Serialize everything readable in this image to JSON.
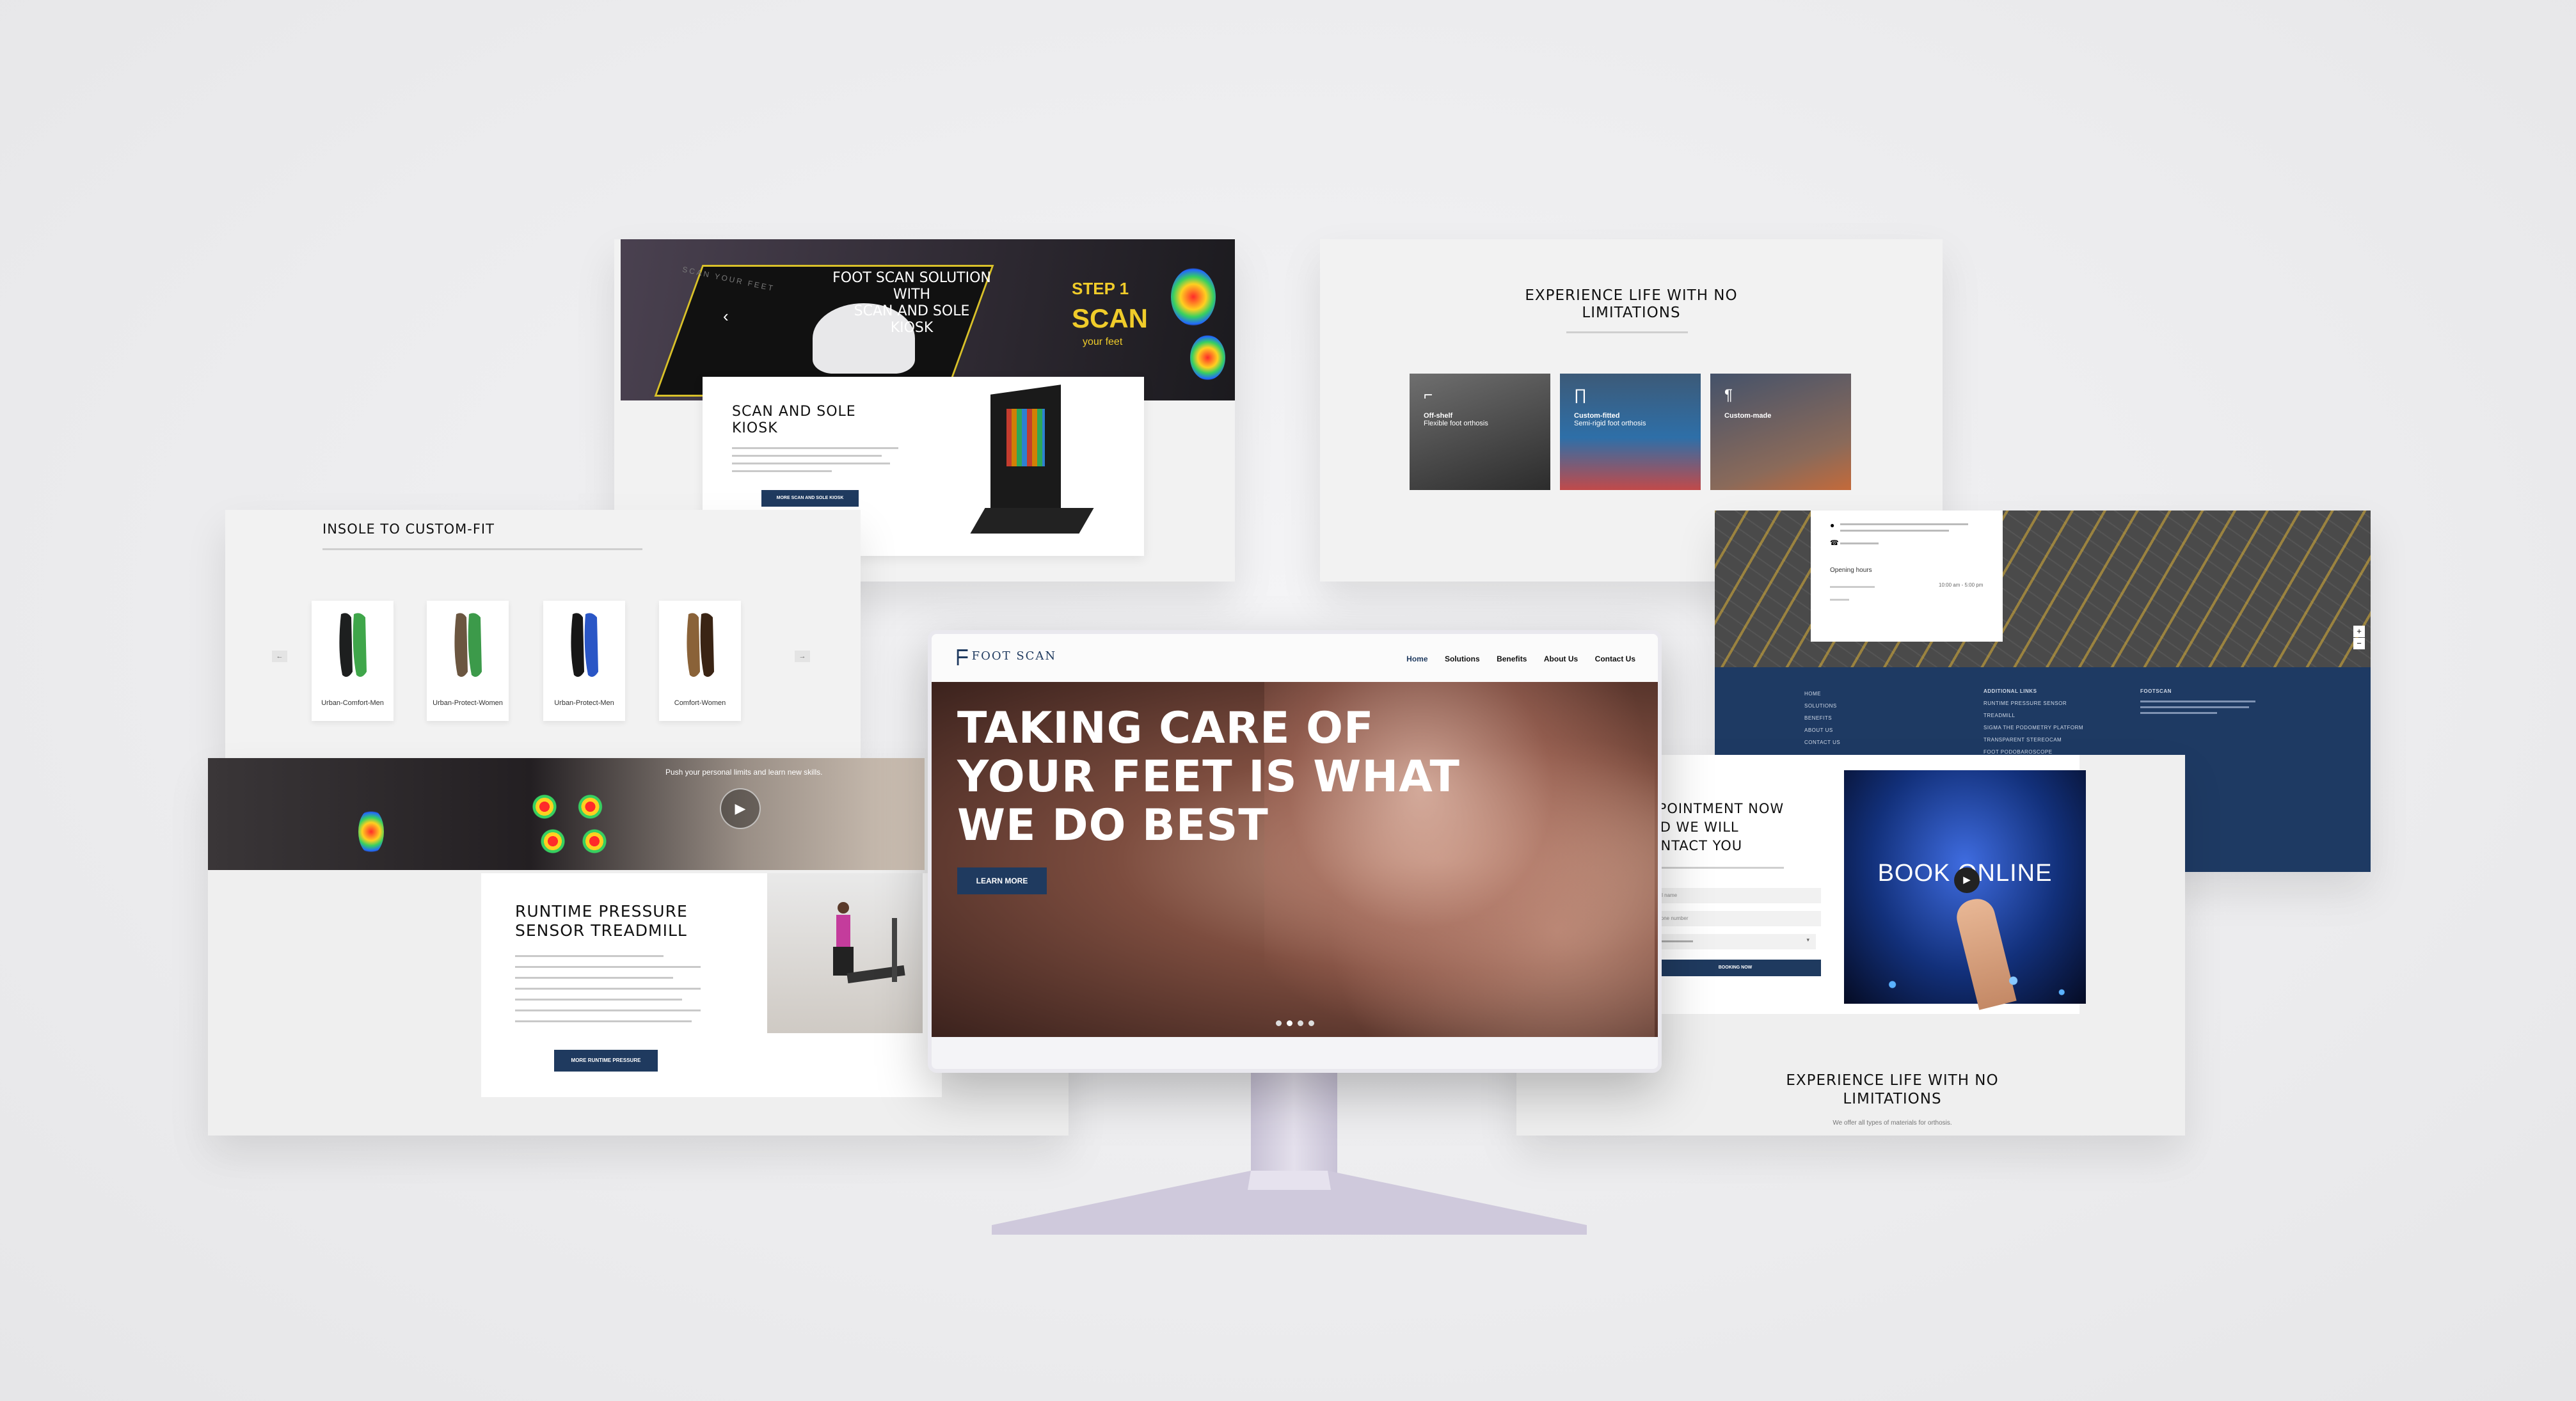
{
  "hero": {
    "logo_text": "FOOT SCAN",
    "nav": [
      "Home",
      "Solutions",
      "Benefits",
      "About Us",
      "Contact Us"
    ],
    "title_line1": "TAKING CARE OF",
    "title_line2": "YOUR FEET IS WHAT",
    "title_line3": "WE DO BEST",
    "cta": "LEARN MORE"
  },
  "kiosk": {
    "banner_line1": "FOOT SCAN SOLUTION",
    "banner_line2": "WITH",
    "banner_line3": "SCAN AND SOLE KIOSK",
    "badge_step": "STEP 1",
    "badge_scan": "SCAN",
    "badge_sub": "your feet",
    "mat_text": "SCAN YOUR FEET",
    "card_title_1": "SCAN AND SOLE",
    "card_title_2": "KIOSK",
    "card_button": "MORE SCAN AND SOLE KIOSK"
  },
  "insoles": {
    "title": "INSOLE TO CUSTOM-FIT",
    "items": [
      {
        "label": "Urban-Comfort-Men",
        "color": "#1d1f1f",
        "accent": "#3fa64a"
      },
      {
        "label": "Urban-Protect-Women",
        "color": "#6b5640",
        "accent": "#3c9a4a"
      },
      {
        "label": "Urban-Protect-Men",
        "color": "#171717",
        "accent": "#2a56c6"
      },
      {
        "label": "Comfort-Women",
        "color": "#8a6238",
        "accent": "#3a2414"
      }
    ],
    "prev": "←",
    "next": "→"
  },
  "offers": {
    "title_line1": "EXPERIENCE LIFE WITH NO",
    "title_line2": "LIMITATIONS",
    "cards": [
      {
        "icon": "boot-icon",
        "title": "Off-shelf",
        "subtitle": "Flexible foot orthosis"
      },
      {
        "icon": "insole-icon",
        "title": "Custom-fitted",
        "subtitle": "Semi-rigid foot orthosis"
      },
      {
        "icon": "foot-icon",
        "title": "Custom-made",
        "subtitle": ""
      }
    ]
  },
  "contact": {
    "opening_hours": "Opening hours",
    "hours_range": "10:00 am - 5:00 pm",
    "footer_col1": [
      "HOME",
      "SOLUTIONS",
      "BENEFITS",
      "ABOUT US",
      "CONTACT US"
    ],
    "footer_col2_title": "ADDITIONAL LINKS",
    "footer_col2": [
      "RUNTIME PRESSURE SENSOR",
      "TREADMILL",
      "SIGMA THE PODOMETRY PLATFORM",
      "TRANSPARENT STEREOCAM",
      "FOOT PODOBAROSCOPE"
    ],
    "footer_col3_title": "FOOTSCAN"
  },
  "treadmill": {
    "banner_text": "Push your personal limits and learn new skills.",
    "title_line1": "RUNTIME PRESSURE",
    "title_line2": "SENSOR TREADMILL",
    "button": "MORE RUNTIME PRESSURE"
  },
  "booking": {
    "title_line1": "PPOINTMENT NOW",
    "title_line2": "ND WE WILL",
    "title_line3": "ONTACT YOU",
    "field_name": "Full name",
    "field_phone": "Phone number",
    "button": "BOOKING NOW",
    "image_text": "BOOK ONLINE",
    "bottom_title_line1": "EXPERIENCE LIFE WITH NO",
    "bottom_title_line2": "LIMITATIONS",
    "bottom_sub": "We offer all types of materials for orthosis."
  },
  "colors": {
    "navy": "#1f3a5f",
    "footer_navy": "#1e3a63"
  }
}
